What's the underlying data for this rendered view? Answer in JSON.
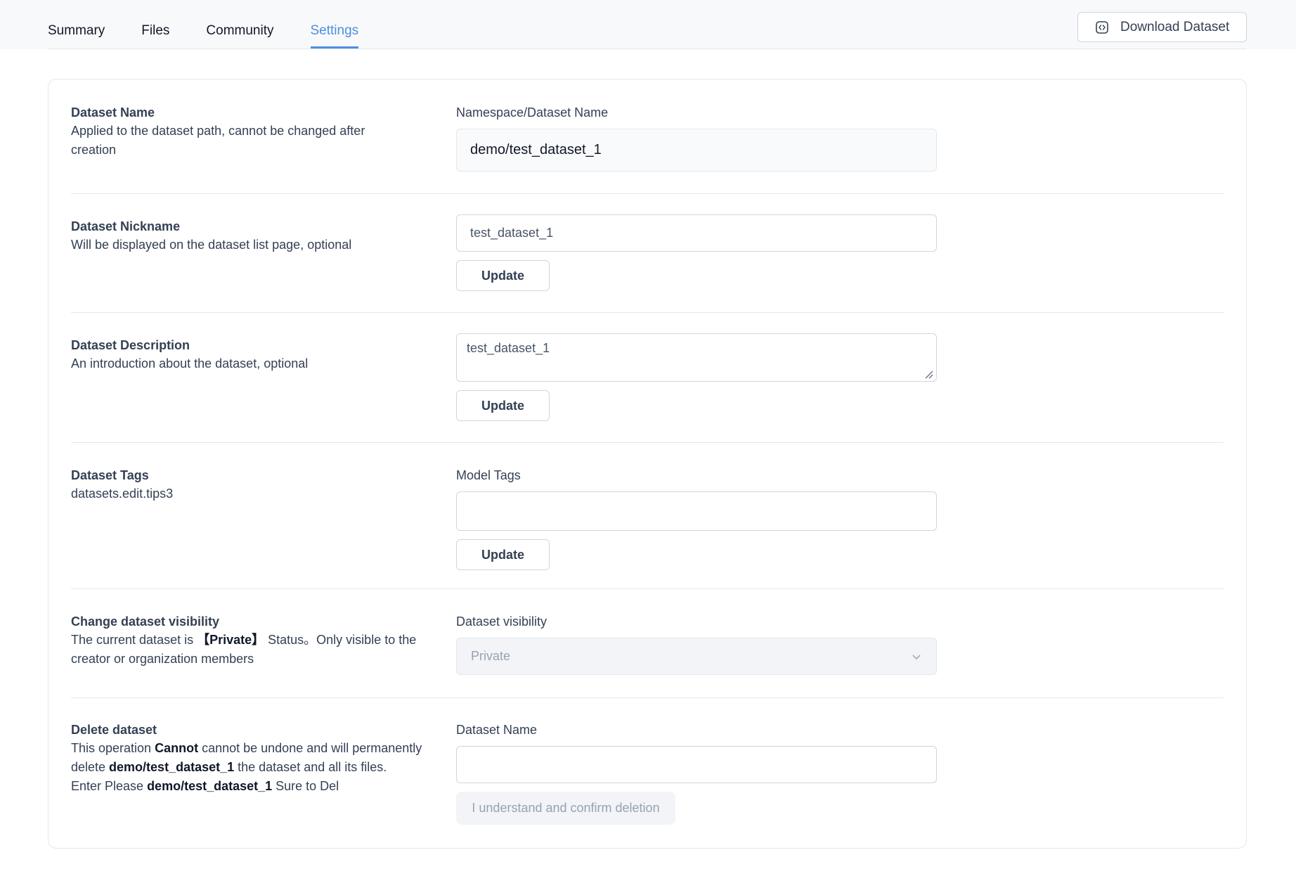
{
  "tabs": [
    {
      "label": "Summary",
      "active": false
    },
    {
      "label": "Files",
      "active": false
    },
    {
      "label": "Community",
      "active": false
    },
    {
      "label": "Settings",
      "active": true
    }
  ],
  "download_button": {
    "label": "Download Dataset",
    "icon": "code-icon"
  },
  "colors": {
    "accent": "#4d8fe0",
    "text": "#344054",
    "border": "#d0d5dd",
    "disabled_bg": "#f2f4f7"
  },
  "name_section": {
    "title": "Dataset Name",
    "desc": "Applied to the dataset path, cannot be changed after creation",
    "field_label": "Namespace/Dataset Name",
    "value": "demo/test_dataset_1"
  },
  "nickname_section": {
    "title": "Dataset Nickname",
    "desc": "Will be displayed on the dataset list page, optional",
    "value": "test_dataset_1",
    "button": "Update"
  },
  "description_section": {
    "title": "Dataset Description",
    "desc": "An introduction about the dataset, optional",
    "value": "test_dataset_1",
    "button": "Update"
  },
  "tags_section": {
    "title": "Dataset Tags",
    "desc": "datasets.edit.tips3",
    "field_label": "Model Tags",
    "value": "",
    "button": "Update"
  },
  "visibility_section": {
    "title": "Change dataset visibility",
    "desc_prefix": "The current dataset is ",
    "desc_status": "【Private】",
    "desc_suffix": " Status。Only visible to the creator or organization members",
    "field_label": "Dataset visibility",
    "selected": "Private"
  },
  "delete_section": {
    "title": "Delete dataset",
    "line1_a": "This operation ",
    "line1_b": "Cannot",
    "line1_c": " cannot be undone and will permanently delete ",
    "line1_d": "demo/test_dataset_1",
    "line1_e": " the dataset and all its files.",
    "line2_a": "Enter Please ",
    "line2_b": "demo/test_dataset_1",
    "line2_c": " Sure to Del",
    "field_label": "Dataset Name",
    "value": "",
    "button": "I understand and confirm deletion"
  }
}
